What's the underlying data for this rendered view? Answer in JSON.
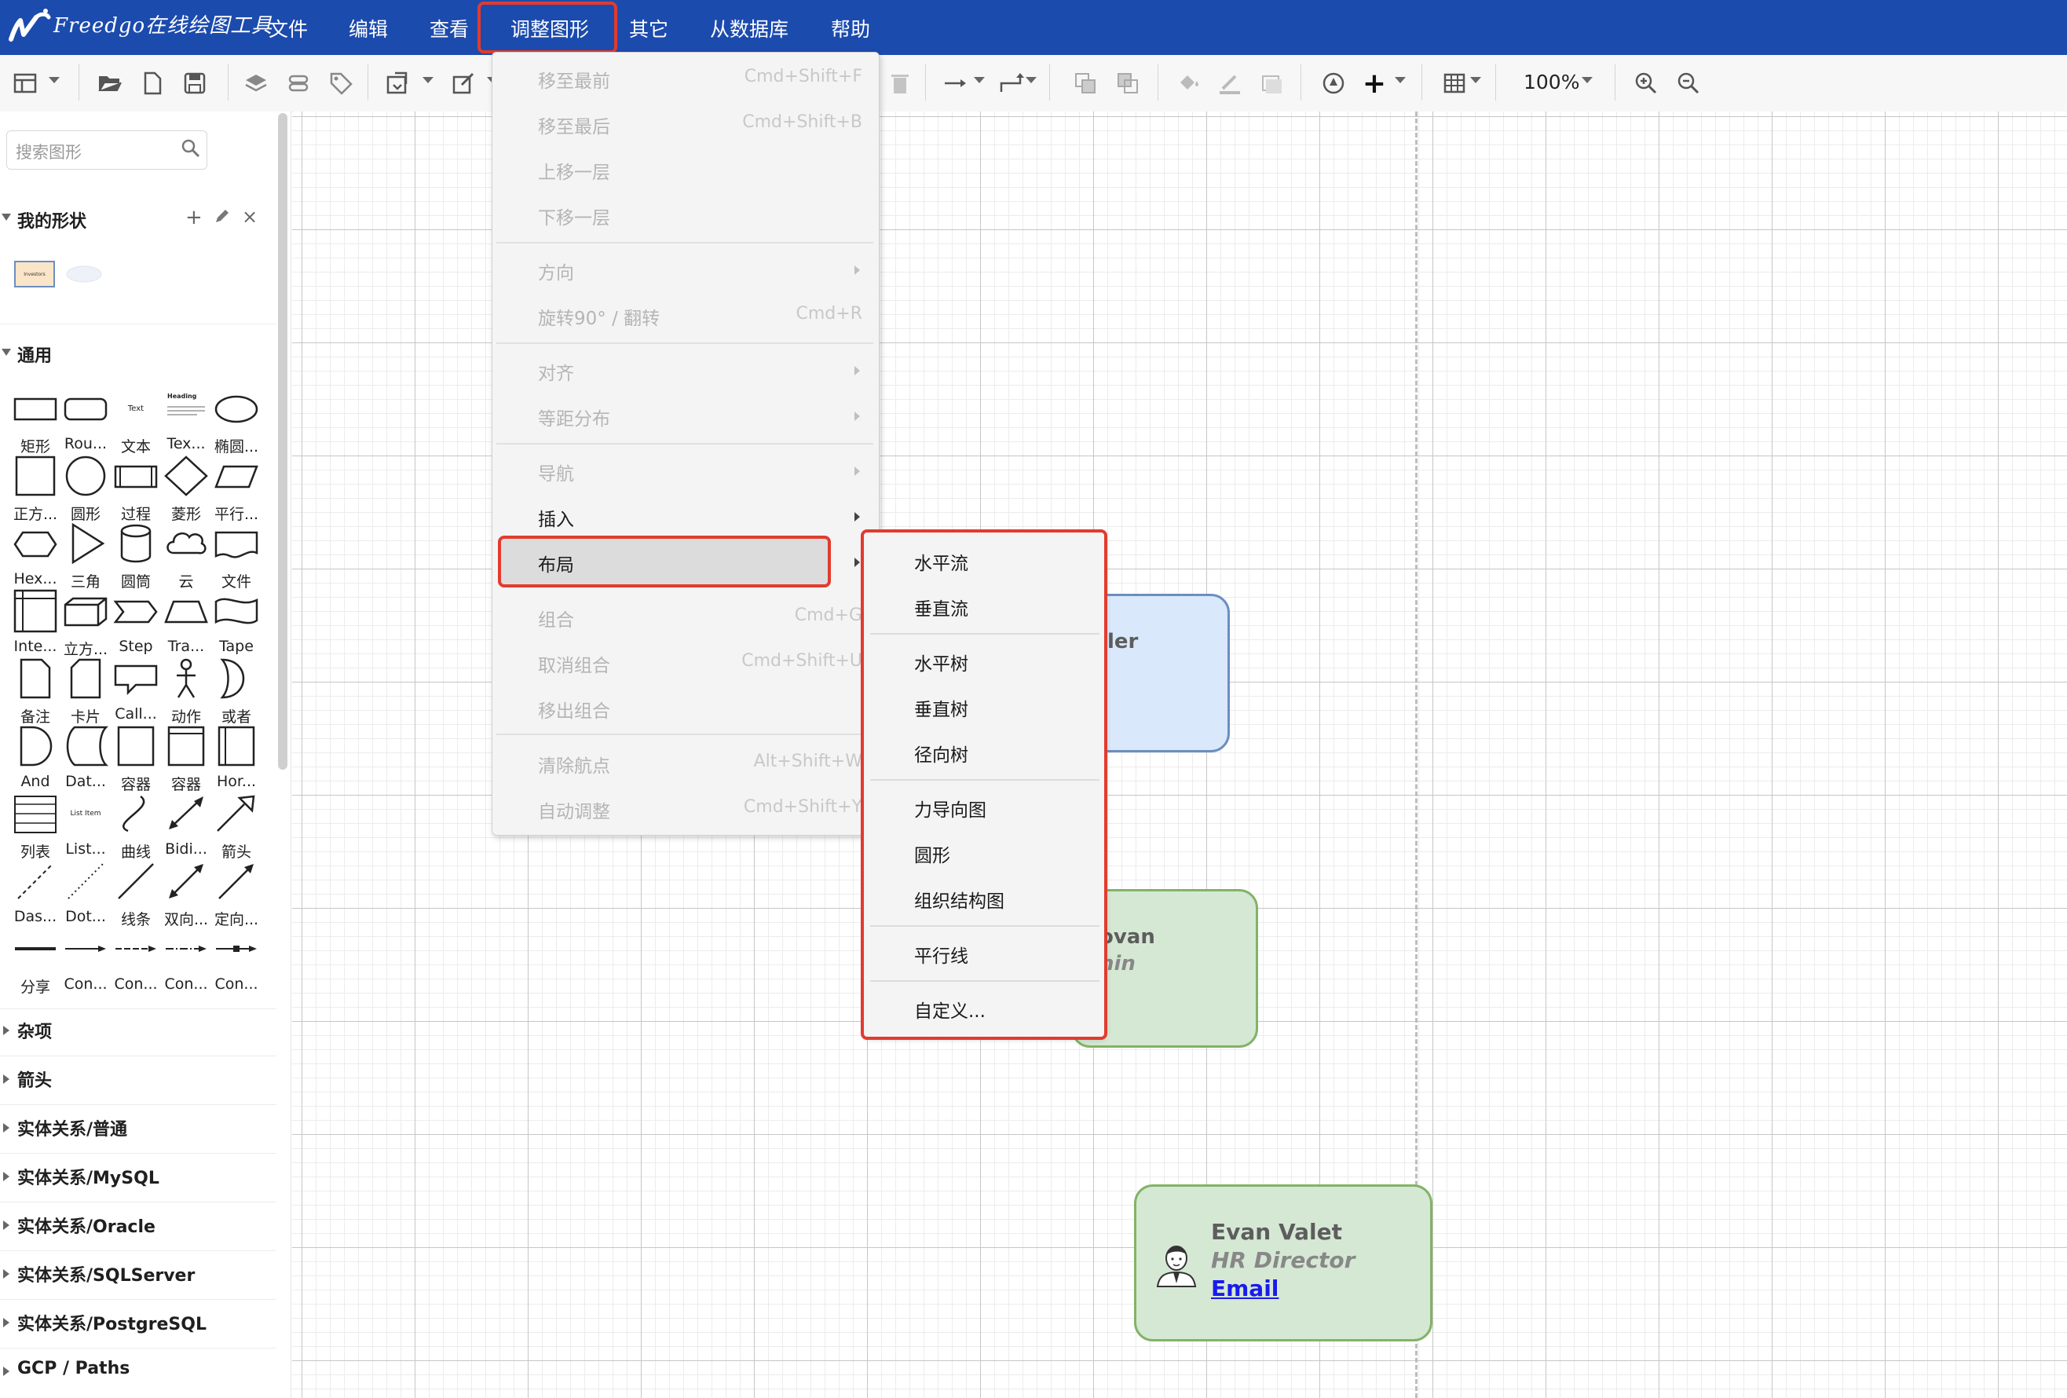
{
  "app": {
    "logo_text": "Freedgo在线绘图工具"
  },
  "menubar": {
    "items": [
      "文件",
      "编辑",
      "查看",
      "调整图形",
      "其它",
      "从数据库",
      "帮助"
    ]
  },
  "toolbar": {
    "zoom": "100%"
  },
  "sidebar": {
    "search_placeholder": "搜索图形",
    "my_shapes": {
      "title": "我的形状",
      "thumb_label": "Investors"
    },
    "general": {
      "title": "通用",
      "labels": [
        "矩形",
        "Rou...",
        "文本",
        "Tex...",
        "椭圆...",
        "正方...",
        "圆形",
        "过程",
        "菱形",
        "平行...",
        "Hex...",
        "三角",
        "圆筒",
        "云",
        "文件",
        "Inte...",
        "立方...",
        "Step",
        "Tra...",
        "Tape",
        "备注",
        "卡片",
        "Call...",
        "动作",
        "或者",
        "And",
        "Dat...",
        "容器",
        "容器",
        "Hor...",
        "列表",
        "List...",
        "曲线",
        "Bidi...",
        "箭头",
        "Das...",
        "Dot...",
        "线条",
        "双向...",
        "定向...",
        "分享",
        "Con...",
        "Con...",
        "Con...",
        "Con..."
      ],
      "text_shape_label": "Text",
      "heading_shape_label": "Heading",
      "list_item_label": "List Item"
    },
    "sections": [
      "杂项",
      "箭头",
      "实体关系/普通",
      "实体关系/MySQL",
      "实体关系/Oracle",
      "实体关系/SQLServer",
      "实体关系/PostgreSQL",
      "GCP / Paths"
    ]
  },
  "canvas": {
    "card_blue": {
      "name_partial": "ler"
    },
    "card_green1": {
      "name_partial": "ovan",
      "title_partial": "nin"
    },
    "card_green2": {
      "name": "Evan Valet",
      "title": "HR Director",
      "link": "Email"
    }
  },
  "menu": {
    "items": [
      {
        "label": "移至最前",
        "shortcut": "Cmd+Shift+F"
      },
      {
        "label": "移至最后",
        "shortcut": "Cmd+Shift+B"
      },
      {
        "label": "上移一层",
        "shortcut": ""
      },
      {
        "label": "下移一层",
        "shortcut": ""
      },
      {
        "label": "方向",
        "shortcut": ""
      },
      {
        "label": "旋转90° / 翻转",
        "shortcut": "Cmd+R"
      },
      {
        "label": "对齐",
        "shortcut": ""
      },
      {
        "label": "等距分布",
        "shortcut": ""
      },
      {
        "label": "导航",
        "shortcut": ""
      },
      {
        "label": "插入",
        "shortcut": ""
      },
      {
        "label": "布局",
        "shortcut": ""
      },
      {
        "label": "组合",
        "shortcut": "Cmd+G"
      },
      {
        "label": "取消组合",
        "shortcut": "Cmd+Shift+U"
      },
      {
        "label": "移出组合",
        "shortcut": ""
      },
      {
        "label": "清除航点",
        "shortcut": "Alt+Shift+W"
      },
      {
        "label": "自动调整",
        "shortcut": "Cmd+Shift+Y"
      }
    ]
  },
  "submenu": {
    "items": [
      "水平流",
      "垂直流",
      "水平树",
      "垂直树",
      "径向树",
      "力导向图",
      "圆形",
      "组织结构图",
      "平行线",
      "自定义..."
    ]
  },
  "colors": {
    "menubar": "#1c4bae",
    "highlight": "#e23b2e",
    "card_blue": "#dae8fc",
    "card_green": "#d5e8d4"
  }
}
